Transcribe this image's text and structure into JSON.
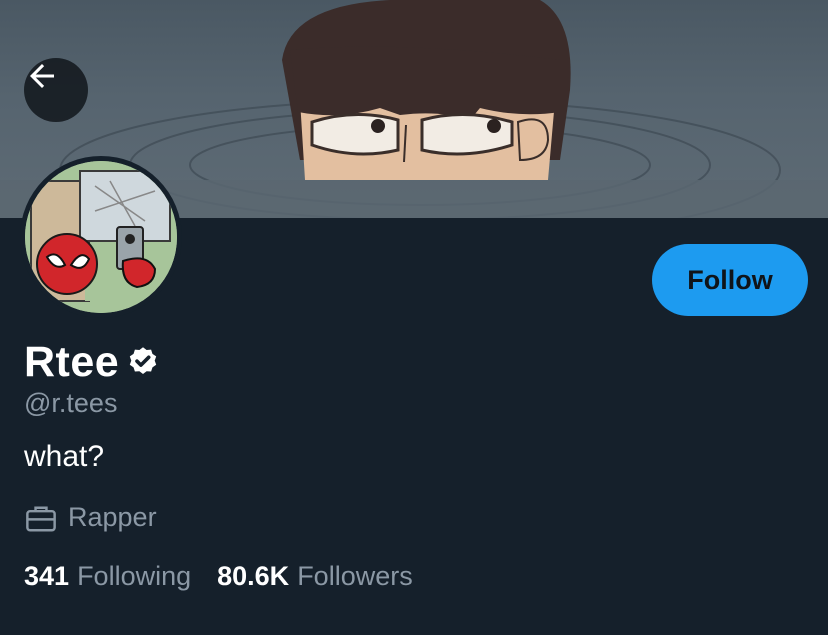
{
  "profile": {
    "display_name": "Rtee",
    "handle": "@r.tees",
    "bio": "what?",
    "profession": "Rapper",
    "verified": true
  },
  "actions": {
    "follow_label": "Follow"
  },
  "stats": {
    "following_count": "341",
    "following_label": "Following",
    "followers_count": "80.6K",
    "followers_label": "Followers"
  },
  "icons": {
    "back": "arrow-left-icon",
    "verified": "verified-badge-icon",
    "profession": "briefcase-icon"
  },
  "colors": {
    "background": "#15202b",
    "accent": "#1d9bf0",
    "secondary_text": "#8b98a5",
    "primary_text": "#ffffff"
  }
}
